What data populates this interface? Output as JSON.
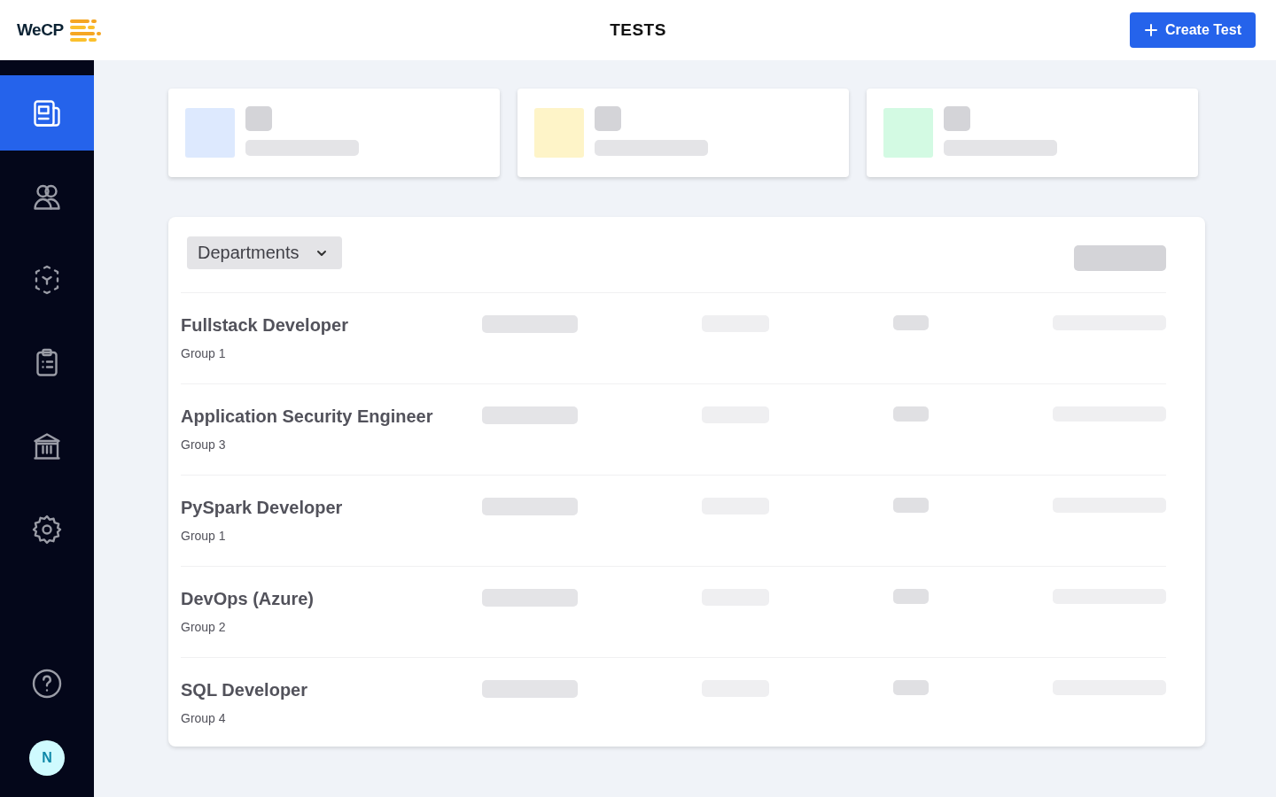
{
  "header": {
    "logo": "WeCP",
    "title": "TESTS",
    "create_button": "Create Test"
  },
  "sidebar": {
    "items": [
      {
        "selected": true
      },
      {
        "selected": false
      },
      {
        "selected": false
      },
      {
        "selected": false
      },
      {
        "selected": false
      },
      {
        "selected": false
      }
    ],
    "avatar": "N"
  },
  "stat_cards": [
    {
      "color": "#dde9fe"
    },
    {
      "color": "#fef4c8"
    },
    {
      "color": "#d3fae3"
    }
  ],
  "filter": {
    "label": "Departments"
  },
  "tests": [
    {
      "name": "Fullstack Developer",
      "group": "Group 1"
    },
    {
      "name": "Application Security Engineer",
      "group": "Group 3"
    },
    {
      "name": "PySpark Developer",
      "group": "Group 1"
    },
    {
      "name": "DevOps (Azure)",
      "group": "Group 2"
    },
    {
      "name": "SQL Developer",
      "group": "Group 4"
    }
  ]
}
